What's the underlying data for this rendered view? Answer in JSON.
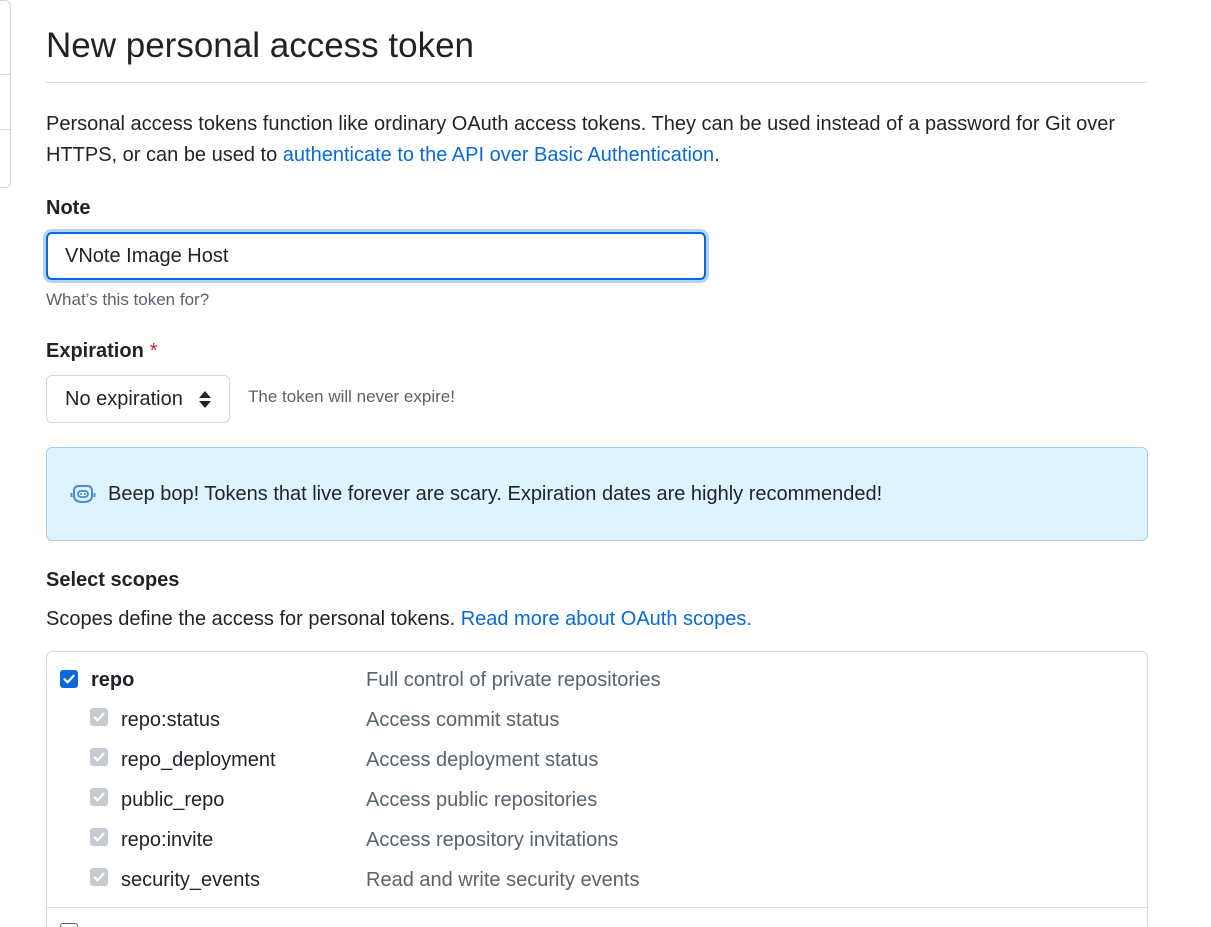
{
  "page": {
    "title": "New personal access token",
    "intro_text": "Personal access tokens function like ordinary OAuth access tokens. They can be used instead of a password for Git over HTTPS, or can be used to ",
    "intro_link": "authenticate to the API over Basic Authentication",
    "intro_end": "."
  },
  "note": {
    "label": "Note",
    "value": "VNote Image Host",
    "hint": "What’s this token for?"
  },
  "expiration": {
    "label": "Expiration",
    "required_mark": "*",
    "selected": "No expiration",
    "note": "The token will never expire!"
  },
  "flash": {
    "icon": "copilot-bot-icon",
    "message": "Beep bop! Tokens that live forever are scary. Expiration dates are highly recommended!"
  },
  "scopes": {
    "title": "Select scopes",
    "description": "Scopes define the access for personal tokens. ",
    "link": "Read more about OAuth scopes.",
    "items": [
      {
        "name": "repo",
        "description": "Full control of private repositories",
        "checked": true,
        "parent": true
      },
      {
        "name": "repo:status",
        "description": "Access commit status",
        "checked": true,
        "parent": false
      },
      {
        "name": "repo_deployment",
        "description": "Access deployment status",
        "checked": true,
        "parent": false
      },
      {
        "name": "public_repo",
        "description": "Access public repositories",
        "checked": true,
        "parent": false
      },
      {
        "name": "repo:invite",
        "description": "Access repository invitations",
        "checked": true,
        "parent": false
      },
      {
        "name": "security_events",
        "description": "Read and write security events",
        "checked": true,
        "parent": false
      }
    ]
  },
  "colors": {
    "accent": "#0969da",
    "flash_bg": "#ddf4ff",
    "required": "#cf222e"
  }
}
